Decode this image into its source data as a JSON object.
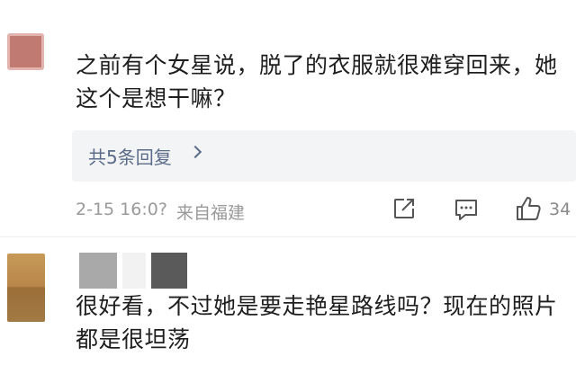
{
  "comments": [
    {
      "text_lines": [
        "之前有个女星说，脱了的衣服就很难穿回来，她",
        "这个是想干嘛？"
      ],
      "replies_label": "共5条回复",
      "time": "2-15 16:0?",
      "location": "来自福建",
      "likes": "34"
    },
    {
      "text_lines": [
        "很好看，不过她是要走艳星路线吗？现在的照片",
        "都是很坦荡"
      ]
    }
  ],
  "colors": {
    "link": "#5b6b8a",
    "meta": "#9a9a9a",
    "text": "#1e1e1e"
  },
  "icons": [
    "share-icon",
    "comment-icon",
    "like-icon",
    "chevron-right-icon"
  ]
}
